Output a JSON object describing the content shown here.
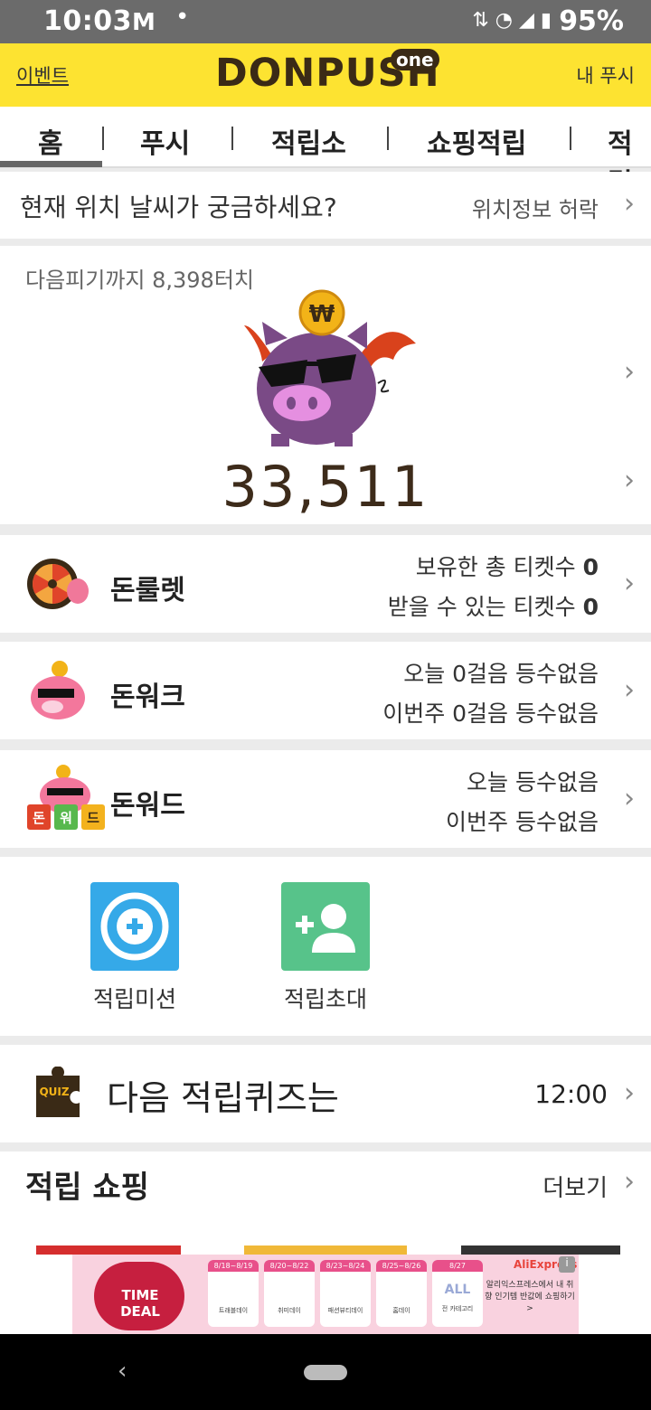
{
  "status": {
    "time": "10:03",
    "mail": "M",
    "dot": "•",
    "battery": "95%"
  },
  "appbar": {
    "event_label": "이벤트",
    "logo": "DONPUSH",
    "logo_badge": "one",
    "my_push_label": "내 푸시"
  },
  "tabs": [
    {
      "label": "홈"
    },
    {
      "label": "푸시"
    },
    {
      "label": "적립소"
    },
    {
      "label": "쇼핑적립"
    },
    {
      "label": "적립"
    }
  ],
  "location": {
    "question": "현재 위치 날씨가 궁금하세요?",
    "action": "위치정보 허락"
  },
  "pig": {
    "next_text": "다음피기까지 8,398터치",
    "count": "33,511",
    "coin_symbol": "₩"
  },
  "rows": [
    {
      "name": "돈룰렛",
      "line1": "보유한 총 티켓수",
      "line1_value": "0",
      "line2": "받을 수 있는 티켓수",
      "line2_value": "0"
    },
    {
      "name": "돈워크",
      "line1": "오늘 0걸음 등수없음",
      "line2": "이번주 0걸음 등수없음"
    },
    {
      "name": "돈워드",
      "line1": "오늘 등수없음",
      "line2": "이번주 등수없음",
      "tiles": [
        "돈",
        "워",
        "드"
      ]
    }
  ],
  "actions": [
    {
      "label": "적립미션"
    },
    {
      "label": "적립초대"
    }
  ],
  "quiz": {
    "badge": "QUIZ",
    "title": "다음 적립퀴즈는",
    "time": "12:00"
  },
  "shop": {
    "title": "적립 쇼핑",
    "more": "더보기",
    "banner": {
      "time_deal": "TIME DEAL",
      "dates": [
        "8/18~8/19",
        "8/20~8/22",
        "8/23~8/24",
        "8/25~8/26",
        "8/27"
      ],
      "categories": [
        "트래블데이",
        "취미데이",
        "패션뷰티데이",
        "홈데이",
        "전 카테고리"
      ],
      "all_label": "ALL",
      "brand": "AliExpress",
      "text": "알리익스프레스에서 내 취향 인기템 반값에 쇼핑하기 >"
    }
  },
  "colors": {
    "header_yellow": "#fde331",
    "logo_brown": "#3a2a16",
    "pig_purple": "#7a4a86",
    "mission_blue": "#35a9e8",
    "invite_green": "#57c38a"
  }
}
